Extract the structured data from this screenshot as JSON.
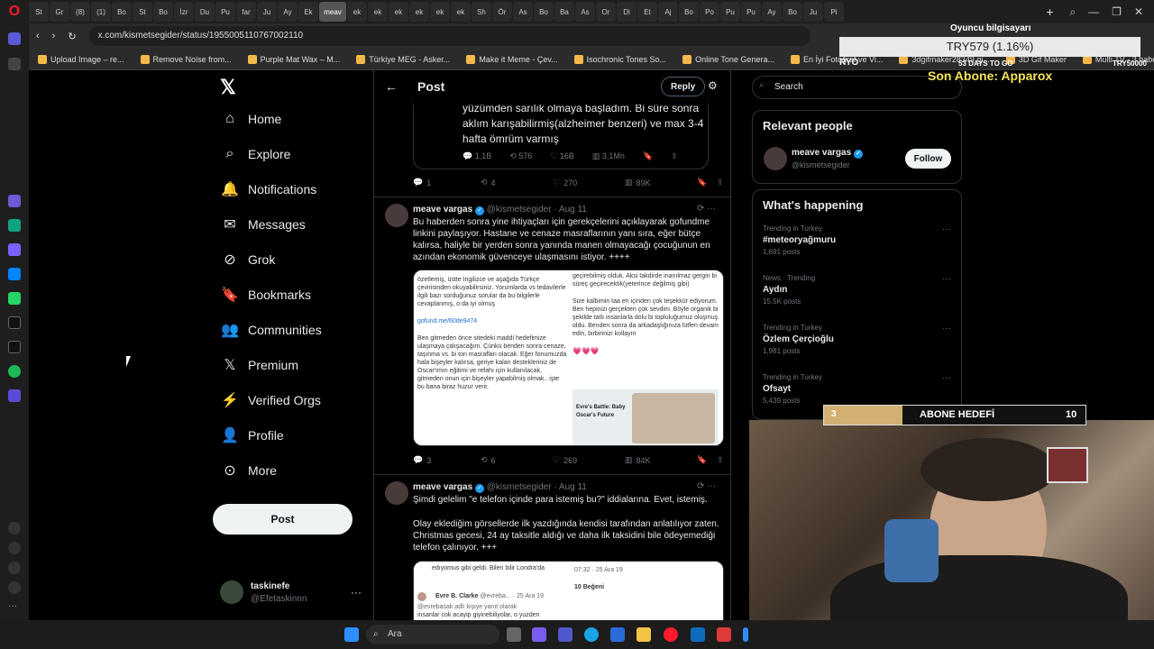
{
  "browser": {
    "logo": "O",
    "tabs": [
      "St",
      "Gr",
      "(8)",
      "(1)",
      "Bo",
      "St",
      "Bo",
      "İzr",
      "Du",
      "Pu",
      "far",
      "Ju",
      "Ay",
      "Ek",
      "meav",
      "ek",
      "ek",
      "ek",
      "ek",
      "ek",
      "ek",
      "Sh",
      "Ör",
      "As",
      "Bo",
      "Ba",
      "As",
      "Or",
      "Di",
      "Et",
      "Aj",
      "Bo",
      "Po",
      "Pu",
      "Pu",
      "Ay",
      "Bo",
      "Ju",
      "Pi"
    ],
    "active_tab": "meav",
    "url": "x.com/kismetsegider/status/1955005110767002110",
    "bookmarks": [
      "Upload Image – re...",
      "Remove Noise from...",
      "Purple Mat Wax – M...",
      "Türkiye MEG - Asker...",
      "Make it Meme - Çev...",
      "Isochronic Tones So...",
      "Online Tone Genera...",
      "En İyi Fotoğraf ve Vi...",
      "3dgifmaker28349.gi...",
      "3D Gif Maker",
      "Multi TV - 3 haber k..."
    ]
  },
  "nav": {
    "items": [
      "Home",
      "Explore",
      "Notifications",
      "Messages",
      "Grok",
      "Bookmarks",
      "Communities",
      "Premium",
      "Verified Orgs",
      "Profile",
      "More"
    ],
    "post_label": "Post"
  },
  "profile": {
    "name": "taskinefe",
    "handle": "@Efetaskinnn",
    "more": "···"
  },
  "header": {
    "title": "Post",
    "reply_label": "Reply"
  },
  "quoted": {
    "text": "yüzümden sarılık olmaya başladım. Bi süre sonra aklım karışabilirmiş(alzheimer benzeri) ve max 3-4 hafta ömrüm varmış",
    "stats": {
      "replies": "1,1B",
      "reposts": "576",
      "likes": "16B",
      "views": "3,1Mn"
    }
  },
  "first_stats": {
    "replies": "1",
    "reposts": "4",
    "likes": "270",
    "views": "89K"
  },
  "tweets": [
    {
      "name": "meave vargas",
      "handle": "@kismetsegider",
      "date": "· Aug 11",
      "text": "Bu haberden sonra yine ihtiyaçları için gerekçelerini açıklayarak gofundme linkini paylaşıyor. Hastane ve cenaze masraflarının yanı sıra, eğer bütçe kalırsa, haliyle bir yerden sonra yanında manen olmayacağı çocuğunun en azından ekonomik güvenceye ulaşmasını istiyor. ++++",
      "media_left": "özetlemiş, üstte İngilizce ve aşağıda Türkçe çevirisinden okuyabilirsiniz. Yorumlarda vs tedavilerle ilgili bazı sorduğunuz sorular da bu bilgilerle cevaplanmış, o da iyi olmuş",
      "media_link": "gofund.me/60de9474",
      "media_left2": "Ben gitmeden önce sitedeki maddi hedefimize ulaşmaya çalışacağım. Çünkü benden sonra cenaze, taşınma vs. bi ton masrafları olacak. Eğer fonumuzda hala bişeyler kalırsa, geriye kalan destekleriniz de Oscar'ımın eğitimi ve refahı için kullanılacak, gitmeden onun için bişeyler yapabilmiş olmak.. işte bu bana biraz huzur verir.",
      "media_right": "geçirebilmiş olduk. Aksi takdirde inanılmaz gergin bi süreç geçirecektik(yeterince değilmiş gibi)",
      "media_right2": "Size kalbimin taa en içinden çok teşekkür ediyorum. Ben hepinizi gerçekten çok sevdim. Böyle organik bi şekilde tatlı insanlarla dolu bi topluluğumuz oluşmuş oldu. Benden sonra da arkadaşlığınıza lütfen devam edin, birbirinizi kollayın",
      "hearts": "💗💗💗",
      "card_title": "Evre's Battle: Baby Oscar's Future",
      "stats": {
        "replies": "3",
        "reposts": "6",
        "likes": "269",
        "views": "84K"
      }
    },
    {
      "name": "meave vargas",
      "handle": "@kismetsegider",
      "date": "· Aug 11",
      "text1": "Şimdi gelelim \"e telefon içinde para istemiş bu?\" iddialarına. Evet, istemiş.",
      "text2": "Olay eklediğim görsellerde ilk yazdığında kendisi tarafından anlatılıyor zaten. Christmas gecesi, 24 ay taksitle aldığı ve daha ilk taksidini bile ödeyemediği telefon çalınıyor. +++",
      "media_top": "edıyomus gibi geldi. Bilen bilir Londra'da",
      "media_time": "07:32 · 25 Ara 19",
      "media_likes": "10 Beğeni",
      "media_user": "Evre B. Clarke",
      "media_user_meta": "@evreba... · 25 Ara 19",
      "media_reply": "@evrebasak adlı kişiye yanıt olarak",
      "media_body": "insanlar cok acayip giyinebiliyolar, o yuzden"
    }
  ],
  "right": {
    "search_placeholder": "Search",
    "relevant_title": "Relevant people",
    "person": {
      "name": "meave vargas",
      "handle": "@kismetsegider",
      "follow_label": "Follow"
    },
    "happening_title": "What's happening",
    "trends": [
      {
        "meta": "Trending in Turkey",
        "name": "#meteoryağmuru",
        "count": "1,691 posts"
      },
      {
        "meta": "News · Trending",
        "name": "Aydın",
        "count": "15.5K posts"
      },
      {
        "meta": "Trending in Turkey",
        "name": "Özlem Çerçioğlu",
        "count": "1,981 posts"
      },
      {
        "meta": "Trending in Turkey",
        "name": "Ofsayt",
        "count": "5,439 posts"
      }
    ]
  },
  "overlay": {
    "oyuncu": "Oyuncu bilgisayarı",
    "try": "TRY579 (1.16%)",
    "ryo": "RYO",
    "days": "53 DAYS TO GO",
    "try_goal": "TRY50000",
    "son_abone": "Son Abone: Apparox",
    "abone_label": "ABONE HEDEFİ",
    "abone_current": "3",
    "abone_max": "10",
    "abone_fraction": 0.3
  },
  "taskbar": {
    "search_label": "Ara"
  },
  "colors": {
    "accent": "#1d9bf0",
    "bg": "#000000",
    "muted": "#71767b",
    "border": "#2f3336",
    "goal": "#f5e35b"
  }
}
